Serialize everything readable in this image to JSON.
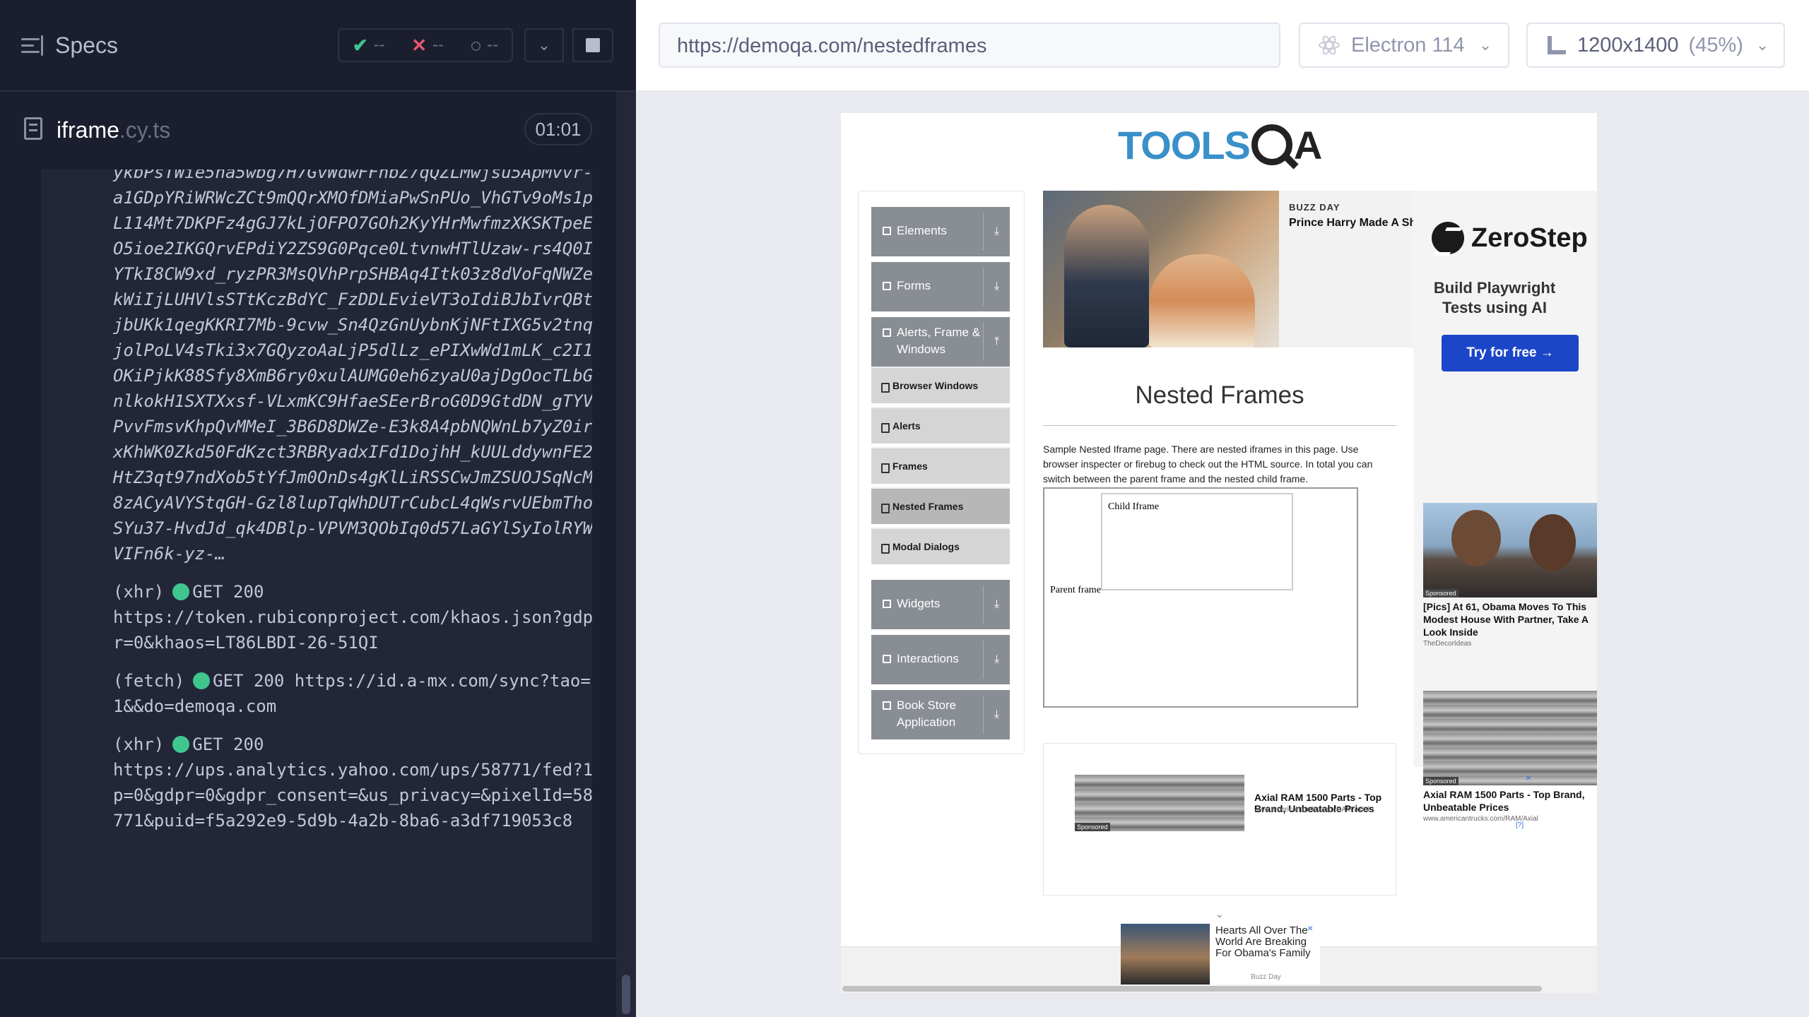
{
  "runner": {
    "specs_label": "Specs",
    "stats": {
      "passed": "--",
      "failed": "--",
      "pending": "--"
    },
    "file": {
      "name": "iframe",
      "ext": ".cy.ts",
      "duration": "01:01"
    },
    "log_blob": "ykbPsTWie5ha5wbg7H7GvWdwFFhbZ7qQZLMwjsu5ApMvvr-a1GDpYRiWRWcZCt9mQQrXMOfDMiaPwSnPUo_VhGTv9oMs1pL114Mt7DKPFz4gGJ7kLjOFPO7GOh2KyYHrMwfmzXKSKTpeEO5ioe2IKGQrvEPdiY2ZS9G0Pqce0LtvnwHTlUzaw-rs4Q0IYTkI8CW9xd_ryzPR3MsQVhPrpSHBAq4Itk03z8dVoFqNWZekWiIjLUHVlsSTtKczBdYC_FzDDLEvieVT3oIdiBJbIvrQBtjbUKk1qegKKRI7Mb-9cvw_Sn4QzGnUybnKjNFtIXG5v2tnqjolPoLV4sTki3x7GQyzoAaLjP5dlLz_ePIXwWd1mLK_c2I1OKiPjkK88Sfy8XmB6ry0xulAUMG0eh6zyaU0ajDgOocTLbGnlkokH1SXTXxsf-VLxmKC9HfaeSEerBroG0D9GtdDN_gTYVPvvFmsvKhpQvMMeI_3B6D8DWZe-E3k8A4pbNQWnLb7yZ0irxKhWK0Zkd50FdKzct3RBRyadxIFd1DojhH_kUULddywnFE2HtZ3qt97ndXob5tYfJm0OnDs4gKlLiRSSCwJmZSUOJSqNcM8zACyAVYStqGH-Gzl8lupTqWhDUTrCubcL4qWsrvUEbmThoSYu37-HvdJd_qk4DBlp-VPVM3QObIq0d57LaGYlSyIolRYWVIFn6k-yz-…",
    "log_entries": [
      {
        "type": "(xhr)",
        "status": "GET 200",
        "url": "https://token.rubiconproject.com/khaos.json?gdpr=0&khaos=LT86LBDI-26-51QI"
      },
      {
        "type": "(fetch)",
        "status": "GET 200",
        "url": "https://id.a-mx.com/sync?tao=1&&do=demoqa.com"
      },
      {
        "type": "(xhr)",
        "status": "GET 200",
        "url": "https://ups.analytics.yahoo.com/ups/58771/fed?1p=0&gdpr=0&gdpr_consent=&us_privacy=&pixelId=58771&puid=f5a292e9-5d9b-4a2b-8ba6-a3df719053c8"
      }
    ]
  },
  "aut_bar": {
    "url": "https://demoqa.com/nestedframes",
    "browser": "Electron 114",
    "viewport": "1200x1400",
    "scale": "(45%)"
  },
  "page": {
    "logo": {
      "left": "TOOLS",
      "right": "A"
    },
    "sidebar": {
      "groups": [
        {
          "label": "Elements"
        },
        {
          "label": "Forms"
        },
        {
          "label": "Alerts, Frame & Windows"
        },
        {
          "label": "Widgets"
        },
        {
          "label": "Interactions"
        },
        {
          "label": "Book Store Application"
        }
      ],
      "sub_items": [
        "Browser Windows",
        "Alerts",
        "Frames",
        "Nested Frames",
        "Modal Dialogs"
      ]
    },
    "news": {
      "kicker": "BUZZ DAY",
      "headline": "Prince Harry Made A Sh"
    },
    "title": "Nested Frames",
    "description": "Sample Nested Iframe page. There are nested iframes in this page. Use browser inspecter or firebug to check out the HTML source. In total you can switch between the parent frame and the nested child frame.",
    "parent_frame_label": "Parent frame",
    "child_frame_label": "Child Iframe",
    "zerostep": {
      "brand": "ZeroStep",
      "tagline": "Build Playwright Tests using AI",
      "cta": "Try for free →"
    },
    "side_ads": [
      {
        "sponsored": "Sponsored",
        "title": "[Pics] At 61, Obama Moves To This Modest House With Partner, Take A Look Inside",
        "source": "TheDecorIdeas"
      },
      {
        "sponsored": "Sponsored",
        "title": "Axial RAM 1500 Parts - Top Brand, Unbeatable Prices",
        "source": "www.americantrucks.com/RAM/Axial"
      }
    ],
    "bottom_ad": {
      "sponsored": "Sponsored",
      "title": "Axial RAM 1500 Parts - Top Brand, Unbeatable Prices",
      "source": "www.americantrucks.com/RAM/Axial",
      "adchoices": "[?]"
    },
    "float_ad": {
      "text": "Hearts All Over The World Are Breaking For Obama's Family",
      "by": "Buzz Day"
    }
  }
}
